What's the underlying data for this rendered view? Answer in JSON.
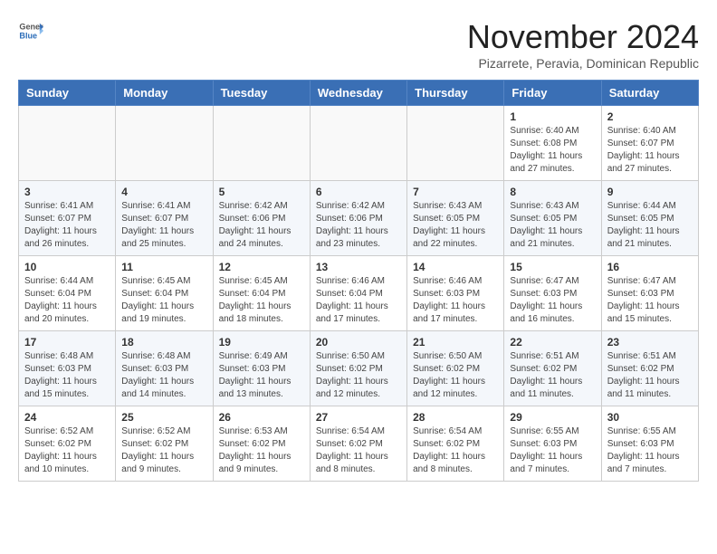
{
  "header": {
    "logo_general": "General",
    "logo_blue": "Blue",
    "month": "November 2024",
    "location": "Pizarrete, Peravia, Dominican Republic"
  },
  "days_of_week": [
    "Sunday",
    "Monday",
    "Tuesday",
    "Wednesday",
    "Thursday",
    "Friday",
    "Saturday"
  ],
  "weeks": [
    [
      {
        "day": "",
        "info": ""
      },
      {
        "day": "",
        "info": ""
      },
      {
        "day": "",
        "info": ""
      },
      {
        "day": "",
        "info": ""
      },
      {
        "day": "",
        "info": ""
      },
      {
        "day": "1",
        "info": "Sunrise: 6:40 AM\nSunset: 6:08 PM\nDaylight: 11 hours and 27 minutes."
      },
      {
        "day": "2",
        "info": "Sunrise: 6:40 AM\nSunset: 6:07 PM\nDaylight: 11 hours and 27 minutes."
      }
    ],
    [
      {
        "day": "3",
        "info": "Sunrise: 6:41 AM\nSunset: 6:07 PM\nDaylight: 11 hours and 26 minutes."
      },
      {
        "day": "4",
        "info": "Sunrise: 6:41 AM\nSunset: 6:07 PM\nDaylight: 11 hours and 25 minutes."
      },
      {
        "day": "5",
        "info": "Sunrise: 6:42 AM\nSunset: 6:06 PM\nDaylight: 11 hours and 24 minutes."
      },
      {
        "day": "6",
        "info": "Sunrise: 6:42 AM\nSunset: 6:06 PM\nDaylight: 11 hours and 23 minutes."
      },
      {
        "day": "7",
        "info": "Sunrise: 6:43 AM\nSunset: 6:05 PM\nDaylight: 11 hours and 22 minutes."
      },
      {
        "day": "8",
        "info": "Sunrise: 6:43 AM\nSunset: 6:05 PM\nDaylight: 11 hours and 21 minutes."
      },
      {
        "day": "9",
        "info": "Sunrise: 6:44 AM\nSunset: 6:05 PM\nDaylight: 11 hours and 21 minutes."
      }
    ],
    [
      {
        "day": "10",
        "info": "Sunrise: 6:44 AM\nSunset: 6:04 PM\nDaylight: 11 hours and 20 minutes."
      },
      {
        "day": "11",
        "info": "Sunrise: 6:45 AM\nSunset: 6:04 PM\nDaylight: 11 hours and 19 minutes."
      },
      {
        "day": "12",
        "info": "Sunrise: 6:45 AM\nSunset: 6:04 PM\nDaylight: 11 hours and 18 minutes."
      },
      {
        "day": "13",
        "info": "Sunrise: 6:46 AM\nSunset: 6:04 PM\nDaylight: 11 hours and 17 minutes."
      },
      {
        "day": "14",
        "info": "Sunrise: 6:46 AM\nSunset: 6:03 PM\nDaylight: 11 hours and 17 minutes."
      },
      {
        "day": "15",
        "info": "Sunrise: 6:47 AM\nSunset: 6:03 PM\nDaylight: 11 hours and 16 minutes."
      },
      {
        "day": "16",
        "info": "Sunrise: 6:47 AM\nSunset: 6:03 PM\nDaylight: 11 hours and 15 minutes."
      }
    ],
    [
      {
        "day": "17",
        "info": "Sunrise: 6:48 AM\nSunset: 6:03 PM\nDaylight: 11 hours and 15 minutes."
      },
      {
        "day": "18",
        "info": "Sunrise: 6:48 AM\nSunset: 6:03 PM\nDaylight: 11 hours and 14 minutes."
      },
      {
        "day": "19",
        "info": "Sunrise: 6:49 AM\nSunset: 6:03 PM\nDaylight: 11 hours and 13 minutes."
      },
      {
        "day": "20",
        "info": "Sunrise: 6:50 AM\nSunset: 6:02 PM\nDaylight: 11 hours and 12 minutes."
      },
      {
        "day": "21",
        "info": "Sunrise: 6:50 AM\nSunset: 6:02 PM\nDaylight: 11 hours and 12 minutes."
      },
      {
        "day": "22",
        "info": "Sunrise: 6:51 AM\nSunset: 6:02 PM\nDaylight: 11 hours and 11 minutes."
      },
      {
        "day": "23",
        "info": "Sunrise: 6:51 AM\nSunset: 6:02 PM\nDaylight: 11 hours and 11 minutes."
      }
    ],
    [
      {
        "day": "24",
        "info": "Sunrise: 6:52 AM\nSunset: 6:02 PM\nDaylight: 11 hours and 10 minutes."
      },
      {
        "day": "25",
        "info": "Sunrise: 6:52 AM\nSunset: 6:02 PM\nDaylight: 11 hours and 9 minutes."
      },
      {
        "day": "26",
        "info": "Sunrise: 6:53 AM\nSunset: 6:02 PM\nDaylight: 11 hours and 9 minutes."
      },
      {
        "day": "27",
        "info": "Sunrise: 6:54 AM\nSunset: 6:02 PM\nDaylight: 11 hours and 8 minutes."
      },
      {
        "day": "28",
        "info": "Sunrise: 6:54 AM\nSunset: 6:02 PM\nDaylight: 11 hours and 8 minutes."
      },
      {
        "day": "29",
        "info": "Sunrise: 6:55 AM\nSunset: 6:03 PM\nDaylight: 11 hours and 7 minutes."
      },
      {
        "day": "30",
        "info": "Sunrise: 6:55 AM\nSunset: 6:03 PM\nDaylight: 11 hours and 7 minutes."
      }
    ]
  ]
}
